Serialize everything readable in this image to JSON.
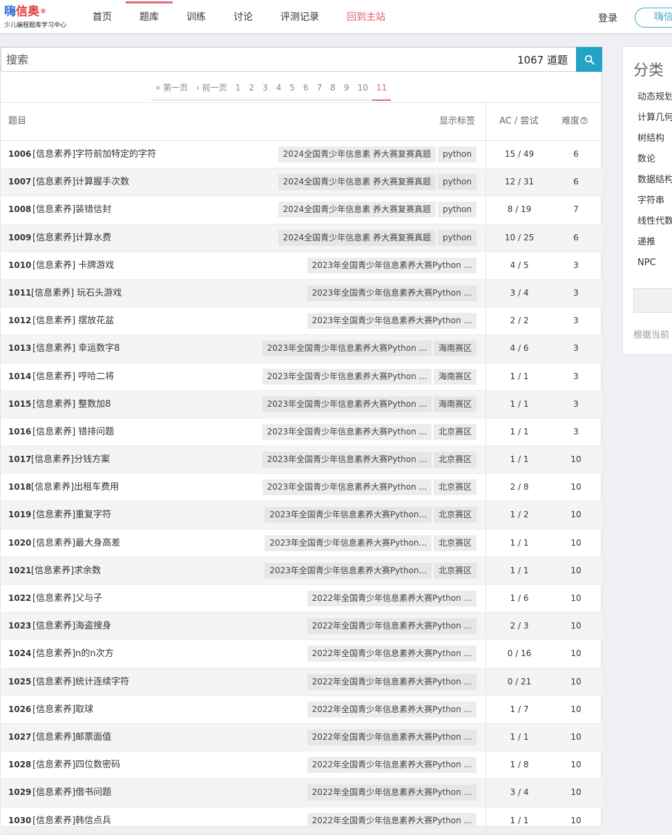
{
  "header": {
    "logo_main_a": "嗨",
    "logo_main_b": "信奥",
    "logo_reg": "®",
    "logo_sub": "少儿编程题库学习中心",
    "nav": [
      "首页",
      "题库",
      "训练",
      "讨论",
      "评测记录",
      "回到主站"
    ],
    "active_nav": "题库",
    "login": "登录",
    "register": "嗨信"
  },
  "search": {
    "placeholder": "搜索",
    "count": "1067 道题"
  },
  "pager": [
    "« 第一页",
    "‹ 前一页",
    "1",
    "2",
    "3",
    "4",
    "5",
    "6",
    "7",
    "8",
    "9",
    "10",
    "11"
  ],
  "pager_current": "11",
  "table": {
    "col_title": "题目",
    "col_tags": "显示标签",
    "col_ac": "AC / 尝试",
    "col_diff": "难度",
    "rows": [
      {
        "id": "1006",
        "title": "[信息素养]字符前加特定的字符",
        "tags": [
          "2024全国青少年信息素 养大赛复赛真题",
          "python"
        ],
        "ac": "15 / 49",
        "diff": "6"
      },
      {
        "id": "1007",
        "title": "[信息素养]计算握手次数",
        "tags": [
          "2024全国青少年信息素 养大赛复赛真题",
          "python"
        ],
        "ac": "12 / 31",
        "diff": "6"
      },
      {
        "id": "1008",
        "title": "[信息素养]装错信封",
        "tags": [
          "2024全国青少年信息素 养大赛复赛真题",
          "python"
        ],
        "ac": "8 / 19",
        "diff": "7"
      },
      {
        "id": "1009",
        "title": "[信息素养]计算水费",
        "tags": [
          "2024全国青少年信息素 养大赛复赛真题",
          "python"
        ],
        "ac": "10 / 25",
        "diff": "6"
      },
      {
        "id": "1010",
        "title": " [信息素养] 卡牌游戏",
        "tags": [
          "2023年全国青少年信息素养大赛Python ..."
        ],
        "ac": "4 / 5",
        "diff": "3"
      },
      {
        "id": "1011",
        "title": "[信息素养] 玩石头游戏",
        "tags": [
          "2023年全国青少年信息素养大赛Python ..."
        ],
        "ac": "3 / 4",
        "diff": "3"
      },
      {
        "id": "1012",
        "title": " [信息素养] 摆放花盆",
        "tags": [
          "2023年全国青少年信息素养大赛Python ..."
        ],
        "ac": "2 / 2",
        "diff": "3"
      },
      {
        "id": "1013",
        "title": " [信息素养] 幸运数字8",
        "tags": [
          "2023年全国青少年信息素养大赛Python ...",
          "海南赛区"
        ],
        "ac": "4 / 6",
        "diff": "3"
      },
      {
        "id": "1014",
        "title": " [信息素养] 哼哈二将",
        "tags": [
          "2023年全国青少年信息素养大赛Python ...",
          "海南赛区"
        ],
        "ac": "1 / 1",
        "diff": "3"
      },
      {
        "id": "1015",
        "title": " [信息素养] 整数加8",
        "tags": [
          "2023年全国青少年信息素养大赛Python ...",
          "海南赛区"
        ],
        "ac": "1 / 1",
        "diff": "3"
      },
      {
        "id": "1016",
        "title": " [信息素养] 错排问题",
        "tags": [
          "2023年全国青少年信息素养大赛Python ...",
          "北京赛区"
        ],
        "ac": "1 / 1",
        "diff": "3"
      },
      {
        "id": "1017",
        "title": "[信息素养]分钱方案",
        "tags": [
          "2023年全国青少年信息素养大赛Python ...",
          "北京赛区"
        ],
        "ac": "1 / 1",
        "diff": "10"
      },
      {
        "id": "1018",
        "title": "[信息素养]出租车费用",
        "tags": [
          "2023年全国青少年信息素养大赛Python ...",
          "北京赛区"
        ],
        "ac": "2 / 8",
        "diff": "10"
      },
      {
        "id": "1019",
        "title": "[信息素养]重复字符",
        "tags": [
          "2023年全国青少年信息素养大赛Python...",
          "北京赛区"
        ],
        "ac": "1 / 2",
        "diff": "10"
      },
      {
        "id": "1020",
        "title": "[信息素养]最大身高差",
        "tags": [
          "2023年全国青少年信息素养大赛Python...",
          "北京赛区"
        ],
        "ac": "1 / 1",
        "diff": "10"
      },
      {
        "id": "1021",
        "title": "[信息素养]求余数",
        "tags": [
          "2023年全国青少年信息素养大赛Python...",
          "北京赛区"
        ],
        "ac": "1 / 1",
        "diff": "10"
      },
      {
        "id": "1022",
        "title": "[信息素养]父与子",
        "tags": [
          "2022年全国青少年信息素养大赛Python ..."
        ],
        "ac": "1 / 6",
        "diff": "10"
      },
      {
        "id": "1023",
        "title": "[信息素养]海盗搜身",
        "tags": [
          "2022年全国青少年信息素养大赛Python ..."
        ],
        "ac": "2 / 3",
        "diff": "10"
      },
      {
        "id": "1024",
        "title": "[信息素养]n的n次方",
        "tags": [
          "2022年全国青少年信息素养大赛Python ..."
        ],
        "ac": "0 / 16",
        "diff": "10"
      },
      {
        "id": "1025",
        "title": "[信息素养]统计连续字符",
        "tags": [
          "2022年全国青少年信息素养大赛Python ..."
        ],
        "ac": "0 / 21",
        "diff": "10"
      },
      {
        "id": "1026",
        "title": "[信息素养]取球",
        "tags": [
          "2022年全国青少年信息素养大赛Python ..."
        ],
        "ac": "1 / 7",
        "diff": "10"
      },
      {
        "id": "1027",
        "title": "[信息素养]邮票面值",
        "tags": [
          "2022年全国青少年信息素养大赛Python ..."
        ],
        "ac": "1 / 1",
        "diff": "10"
      },
      {
        "id": "1028",
        "title": "[信息素养]四位数密码",
        "tags": [
          "2022年全国青少年信息素养大赛Python ..."
        ],
        "ac": "1 / 8",
        "diff": "10"
      },
      {
        "id": "1029",
        "title": "[信息素养]借书问题",
        "tags": [
          "2022年全国青少年信息素养大赛Python ..."
        ],
        "ac": "3 / 4",
        "diff": "10"
      },
      {
        "id": "1030",
        "title": "[信息素养]韩信点兵",
        "tags": [
          "2022年全国青少年信息素养大赛Python ..."
        ],
        "ac": "1 / 1",
        "diff": "10"
      }
    ]
  },
  "sidebar": {
    "title": "分类",
    "items": [
      "动态规划",
      "计算几何",
      "树结构",
      "数论",
      "数据结构",
      "字符串",
      "线性代数",
      "递推",
      "NPC"
    ],
    "note": "根据当前"
  },
  "colors": {
    "accent": "#23a3c6",
    "nav_active": "#e0667a",
    "home_link": "#e05a6b"
  }
}
